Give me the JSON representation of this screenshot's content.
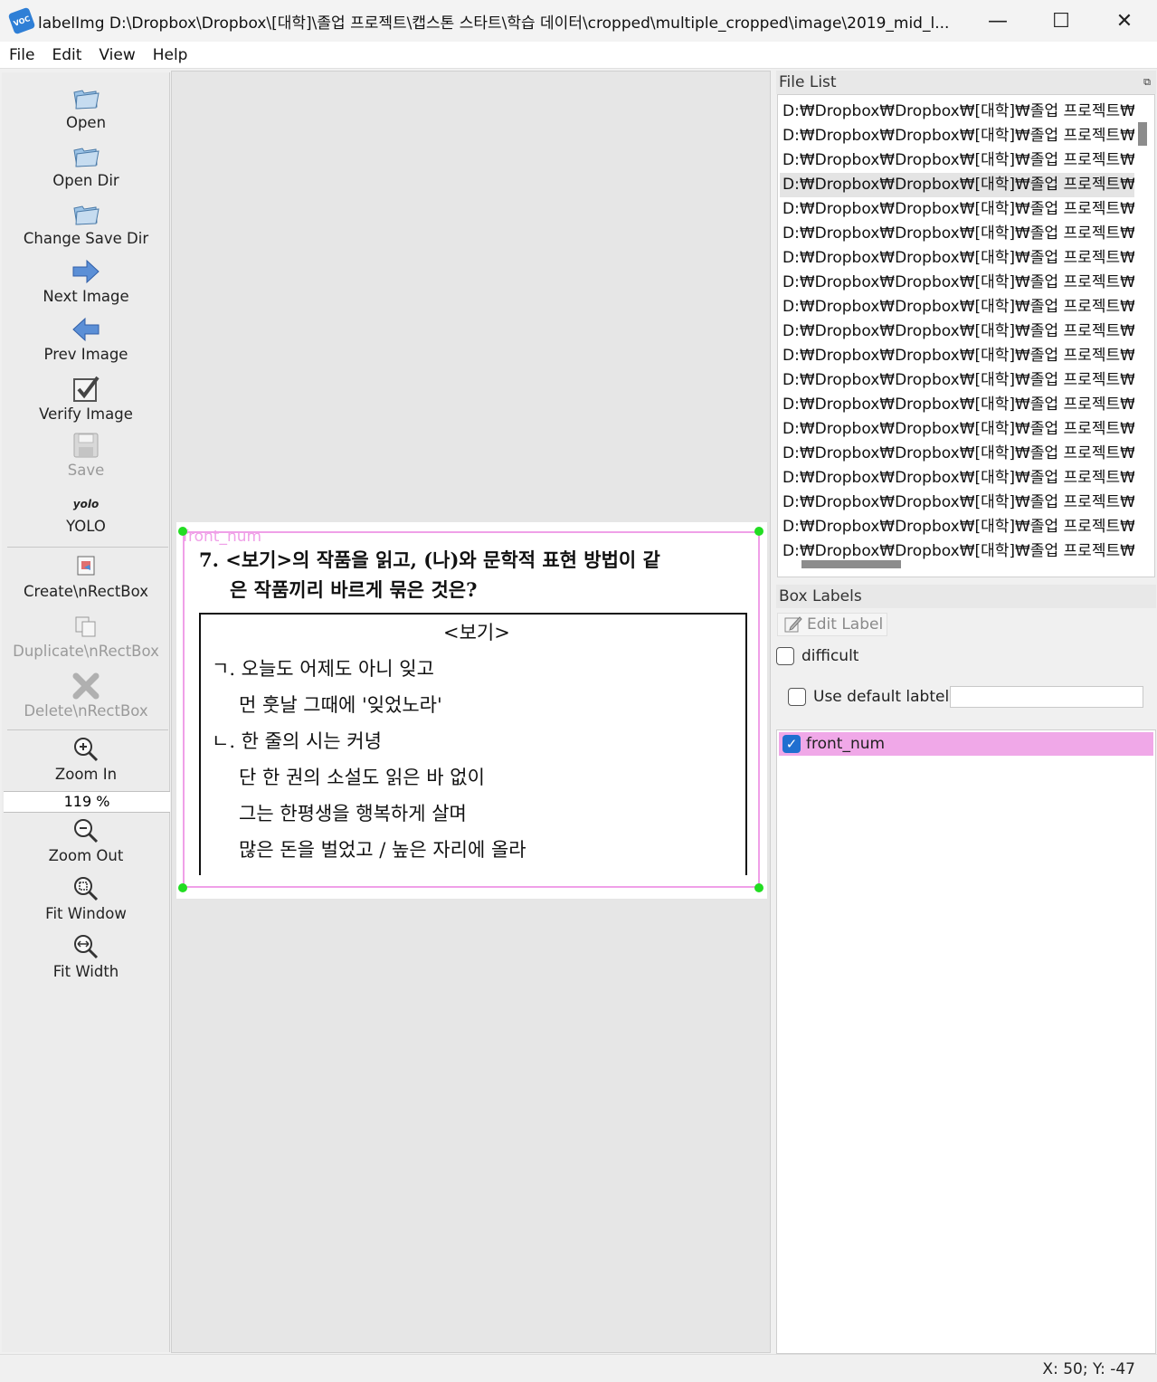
{
  "window": {
    "title": "labelImg D:\\Dropbox\\Dropbox\\[대학]\\졸업 프로젝트\\캡스톤 스타트\\학습 데이터\\cropped\\multiple_cropped\\image\\2019_mid_l...",
    "minimize": "—",
    "maximize": "☐",
    "close": "✕"
  },
  "menu": {
    "file": "File",
    "edit": "Edit",
    "view": "View",
    "help": "Help"
  },
  "toolbar": {
    "open": "Open",
    "open_dir": "Open Dir",
    "change_save_dir": "Change Save Dir",
    "next_image": "Next Image",
    "prev_image": "Prev Image",
    "verify_image": "Verify Image",
    "save": "Save",
    "format_icon_text": "yolo",
    "format": "YOLO",
    "create_rectbox": "Create\\nRectBox",
    "duplicate_rectbox": "Duplicate\\nRectBox",
    "delete_rectbox": "Delete\\nRectBox",
    "zoom_in": "Zoom In",
    "zoom_value": "119 %",
    "zoom_out": "Zoom Out",
    "fit_window": "Fit Window",
    "fit_width": "Fit Width"
  },
  "canvas": {
    "box_label": "front_num",
    "question_line1": "7.   <보기>의 작품을 읽고, (나)와 문학적 표현 방법이 같",
    "question_line2": "은 작품끼리 바르게 묶은 것은?",
    "box_title": "<보기>",
    "box_lines": [
      "ㄱ. 오늘도 어제도 아니 잊고",
      "먼 훗날 그때에 '잊었노라'",
      "ㄴ. 한 줄의 시는 커녕",
      "단 한 권의 소설도 읽은 바 없이",
      "그는 한평생을 행복하게 살며",
      "많은 돈을 벌었고 / 높은 자리에 올라"
    ]
  },
  "file_list": {
    "title": "File List",
    "selected_index": 3,
    "items": [
      "D:₩Dropbox₩Dropbox₩[대학]₩졸업 프로젝트₩",
      "D:₩Dropbox₩Dropbox₩[대학]₩졸업 프로젝트₩",
      "D:₩Dropbox₩Dropbox₩[대학]₩졸업 프로젝트₩",
      "D:₩Dropbox₩Dropbox₩[대학]₩졸업 프로젝트₩",
      "D:₩Dropbox₩Dropbox₩[대학]₩졸업 프로젝트₩",
      "D:₩Dropbox₩Dropbox₩[대학]₩졸업 프로젝트₩",
      "D:₩Dropbox₩Dropbox₩[대학]₩졸업 프로젝트₩",
      "D:₩Dropbox₩Dropbox₩[대학]₩졸업 프로젝트₩",
      "D:₩Dropbox₩Dropbox₩[대학]₩졸업 프로젝트₩",
      "D:₩Dropbox₩Dropbox₩[대학]₩졸업 프로젝트₩",
      "D:₩Dropbox₩Dropbox₩[대학]₩졸업 프로젝트₩",
      "D:₩Dropbox₩Dropbox₩[대학]₩졸업 프로젝트₩",
      "D:₩Dropbox₩Dropbox₩[대학]₩졸업 프로젝트₩",
      "D:₩Dropbox₩Dropbox₩[대학]₩졸업 프로젝트₩",
      "D:₩Dropbox₩Dropbox₩[대학]₩졸업 프로젝트₩",
      "D:₩Dropbox₩Dropbox₩[대학]₩졸업 프로젝트₩",
      "D:₩Dropbox₩Dropbox₩[대학]₩졸업 프로젝트₩",
      "D:₩Dropbox₩Dropbox₩[대학]₩졸업 프로젝트₩",
      "D:₩Dropbox₩Dropbox₩[대학]₩졸업 프로젝트₩"
    ]
  },
  "box_labels": {
    "title": "Box Labels",
    "edit_label": "Edit Label",
    "difficult": "difficult",
    "use_default_label": "Use default labtel",
    "default_label_value": "",
    "labels": [
      {
        "name": "front_num",
        "checked": true,
        "color": "#f0a8e8"
      }
    ]
  },
  "status": {
    "coords": "X: 50; Y: -47"
  }
}
